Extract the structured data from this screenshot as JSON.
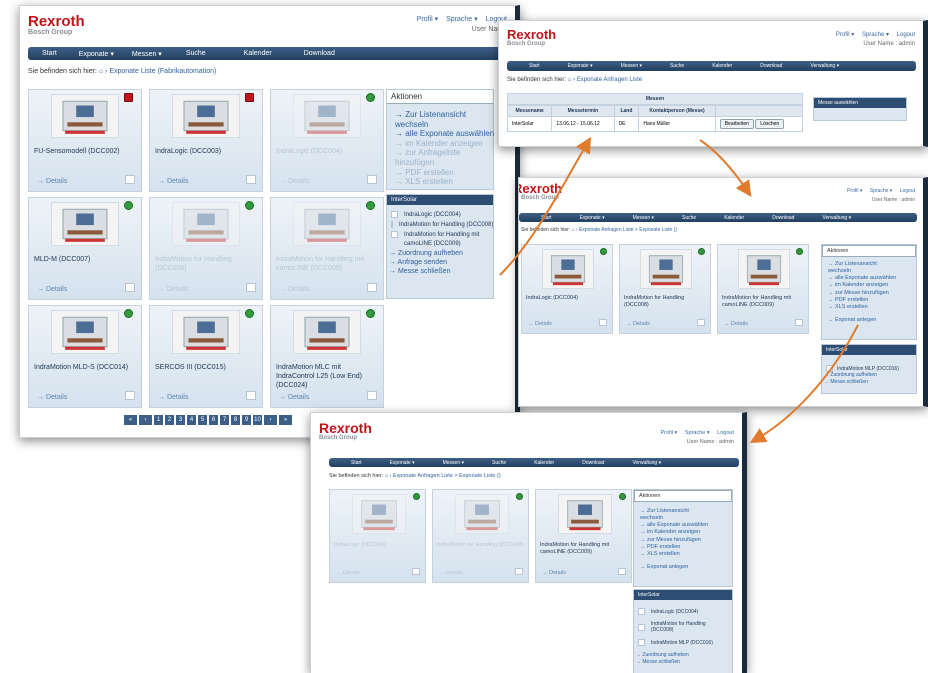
{
  "brand": {
    "name": "Rexroth",
    "group": "Bosch Group"
  },
  "top_links": [
    "Profil ▾",
    "Sprache ▾",
    "Logout"
  ],
  "user_name": "User Name",
  "user_name_admin": "User Name : admin",
  "nav1": [
    "Start",
    "Exponate ▾",
    "Messen ▾",
    "Suche",
    "Kalender",
    "Download"
  ],
  "nav2": [
    "Start",
    "Exponate ▾",
    "Messen ▾",
    "Suche",
    "Kalender",
    "Download",
    "Verwaltung ▾"
  ],
  "bc_prefix": "Sie befinden sich hier:",
  "bc1": "Exponate Liste (Fabrikautomation)",
  "bc2": "Exponate Anfragen Liste",
  "bc3": "Exponate Anfragen Liste  >  Exponate Liste ()",
  "w1_cards": [
    {
      "title": "FU-Sensomodell (DCC002)",
      "status": "red"
    },
    {
      "title": "IndraLogic (DCC003)",
      "status": "red"
    },
    {
      "title": "IndraLogic (DCC004)",
      "status": "green",
      "dim": true
    },
    {
      "title": "MLD-M (DCC007)",
      "status": "green"
    },
    {
      "title": "IndraMotion for Handling (DCC008)",
      "status": "green",
      "dim": true
    },
    {
      "title": "IndraMotion for Handling mit camoLINE (DCC009)",
      "status": "green",
      "dim": true
    },
    {
      "title": "IndraMotion MLD-S (DCC014)",
      "status": "green"
    },
    {
      "title": "SERCOS III (DCC015)",
      "status": "green"
    },
    {
      "title": "IndraMotion MLC mit IndraControl L25 (Low End) (DCC024)",
      "status": "green"
    }
  ],
  "details": "→ Details",
  "pagination": [
    "«",
    "‹",
    "1",
    "2",
    "3",
    "4",
    "5",
    "6",
    "7",
    "8",
    "9",
    "10",
    "›",
    "»"
  ],
  "aktionen": "Aktionen",
  "w1_actions": [
    {
      "t": "→ Zur Listenansicht",
      "g": false
    },
    {
      "t": "   wechseln",
      "g": false
    },
    {
      "t": "→ alle Exponate auswählen",
      "g": false
    },
    {
      "t": "→ im Kalender anzeigen",
      "g": true
    },
    {
      "t": "→ zur Anfrageliste",
      "g": true
    },
    {
      "t": "   hinzufügen",
      "g": true
    },
    {
      "t": "→ PDF erstellen",
      "g": true
    },
    {
      "t": "→ XLS erstellen",
      "g": true
    }
  ],
  "intersolar": "InterSolar",
  "w1_sel": [
    "IndraLogic (DCC004)",
    "IndraMotion for Handling (DCC008)",
    "IndraMotion for Handling mit",
    "camoLINE (DCC009)"
  ],
  "w1_sel_actions": [
    "→ Zuordnung aufheben",
    "→ Anfrage senden",
    "→ Messe schließen"
  ],
  "w2_table_title": "Messen",
  "w2_headers": [
    "Messename",
    "Messetermin",
    "Land",
    "Kontaktperson (Messe)"
  ],
  "w2_row": [
    "InterSolar",
    "13.06.12 - 15.06.12",
    "DE",
    "Hans Müller"
  ],
  "w2_buttons": [
    "Bearbeiten",
    "Löschen"
  ],
  "messe_auswaehlen": "Messe auswählen",
  "w3_cards": [
    {
      "title": "IndraLogic (DCC004)"
    },
    {
      "title": "IndraMotion for Handling (DCC008)"
    },
    {
      "title": "IndraMotion for Handling mit camoLINE (DCC009)"
    }
  ],
  "w3_actions": [
    "→ Zur Listenansicht",
    "   wechseln",
    "→ alle Exponate auswählen",
    "→ im Kalender anzeigen",
    "→ zur Messe hinzufügen",
    "→ PDF erstellen",
    "→ XLS erstellen",
    "",
    "→ Exponat anlegen"
  ],
  "w3_sel": [
    "IndraMotion MLP (DCC016)"
  ],
  "w3_sel_actions": [
    "→ Zuordnung aufheben",
    "→ Messe schließen"
  ],
  "w4_actions": [
    "→ Zur Listenansicht",
    "   wechseln",
    "→ alle Exponate auswählen",
    "→ im Kalender anzeigen",
    "→ zur Messe hinzufügen",
    "→ PDF erstellen",
    "→ XLS erstellen",
    "",
    "→ Exponat anlegen"
  ],
  "w4_sel": [
    "IndraLogic (DCC004)",
    "IndraMotion for Handling (DCC008)",
    "IndraMotion MLP (DCC016)"
  ],
  "w4_sel_actions": [
    "→ Zuordnung aufheben",
    "→ Messe schließen"
  ],
  "colors": {
    "brand": "#c0151b",
    "nav": "#2d4d72",
    "link": "#2f62a0",
    "arrow": "#e07a2c",
    "ok": "#2f9b3a"
  }
}
